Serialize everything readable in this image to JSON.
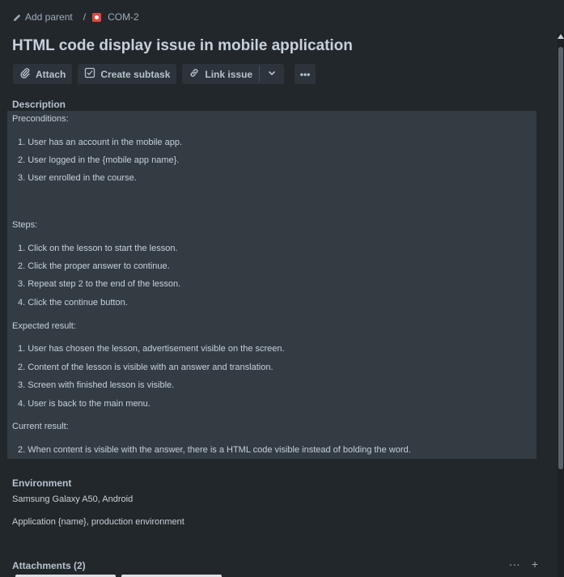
{
  "breadcrumb": {
    "add_parent": "Add parent",
    "separator": "/",
    "issue_key": "COM-2"
  },
  "title": "HTML code display issue in mobile application",
  "toolbar": {
    "attach": "Attach",
    "create_subtask": "Create subtask",
    "link_issue": "Link issue",
    "more": "•••"
  },
  "description": {
    "heading": "Description",
    "preconditions": "Preconditions:",
    "precondition_items": [
      "1. User has an account in the mobile app.",
      "2. User logged in the {mobile app name}.",
      "3. User enrolled in the course."
    ],
    "steps": "Steps:",
    "step_items": [
      "1. Click on the lesson to start the lesson.",
      "2. Click the proper answer to continue.",
      "3. Repeat step 2 to the end of the lesson.",
      "4. Click the continue button."
    ],
    "expected": "Expected result:",
    "expected_items": [
      "1. User has chosen the lesson, advertisement visible on the screen.",
      "2. Content of the lesson is visible with an answer and translation.",
      "3. Screen with finished lesson is visible.",
      "4. User is back to the main menu."
    ],
    "current": "Current result:",
    "current_items": [
      "2. When content is visible with the answer, there is a HTML code visible instead of bolding the word."
    ]
  },
  "environment": {
    "heading": "Environment",
    "line1": "Samsung Galaxy A50, Android",
    "line2": "Application {name}, production environment"
  },
  "attachments": {
    "heading": "Attachments (2)",
    "more": "···",
    "add": "+"
  },
  "icons": {
    "pencil": "pencil-icon",
    "issue_type": "bug-icon",
    "paperclip": "paperclip-icon",
    "subtask": "subtask-icon",
    "link": "link-icon",
    "chevron": "chevron-down-icon"
  },
  "colors": {
    "background": "#22272b",
    "panel": "#333b43",
    "button": "#2c333a",
    "bug": "#e2483d"
  }
}
